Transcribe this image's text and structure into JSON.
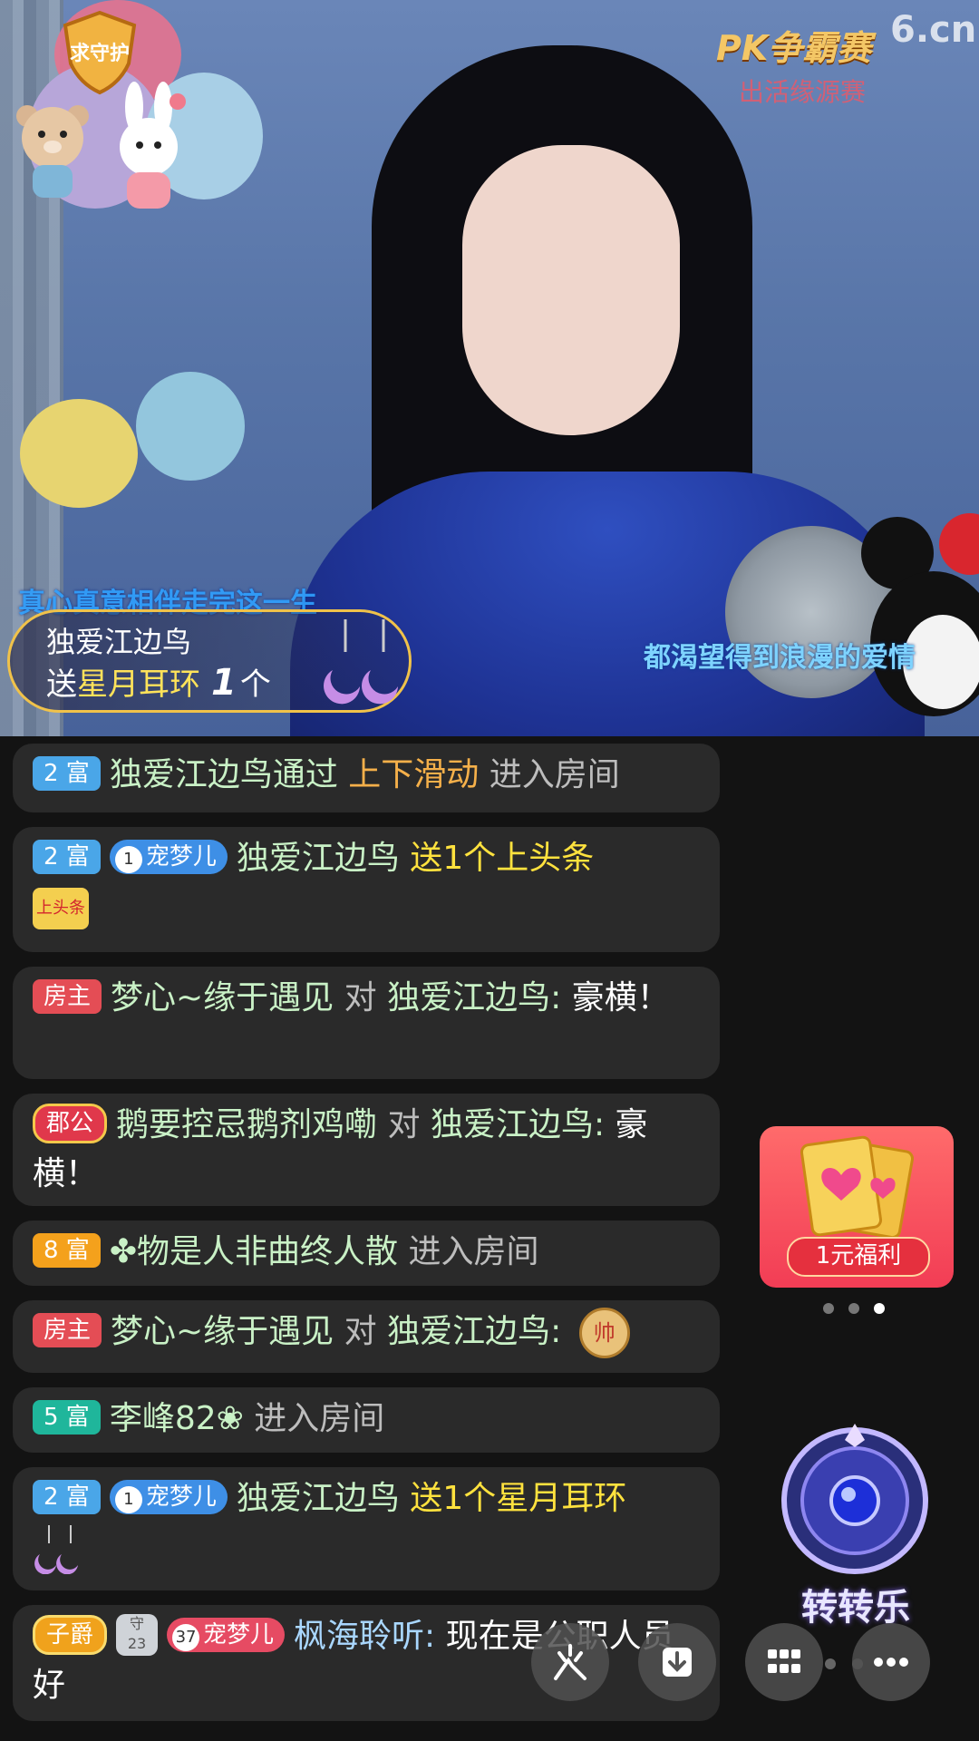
{
  "stream": {
    "logo_pk": "PK争霸赛",
    "logo_pk_sub": "出活缘源赛",
    "logo_site": "6.cn",
    "caption_top": "真心真意相伴走完这一生",
    "caption_right": "都渴望得到浪漫的爱情",
    "gift_banner": {
      "user": "独爱江边鸟",
      "send_prefix": "送",
      "gift_name": "星月耳环",
      "count": "1",
      "unit": "个"
    }
  },
  "chat": [
    {
      "badge": "2 富",
      "user": "独爱江边鸟",
      "text1": "通过",
      "text2": "上下滑动",
      "text3": "进入房间"
    },
    {
      "badge": "2 富",
      "pet_level": "1",
      "pet_name": "宠梦儿",
      "user": "独爱江边鸟",
      "action": "送1个上头条",
      "gift_label": "上头条"
    },
    {
      "badge": "房主",
      "user": "梦心~缘于遇见",
      "to": "对",
      "target": "独爱江边鸟:",
      "content": "豪横！"
    },
    {
      "badge": "郡公",
      "user": "鹅要控忌鹅剂鸡嘞",
      "to": "对",
      "target": "独爱江边鸟:",
      "content": "豪横！"
    },
    {
      "badge": "8 富",
      "user": "✤物是人非曲终人散",
      "text": "进入房间"
    },
    {
      "badge": "房主",
      "user": "梦心~缘于遇见",
      "to": "对",
      "target": "独爱江边鸟:",
      "emoji": "帅"
    },
    {
      "badge": "5 富",
      "user": "李峰82❀",
      "text": "进入房间"
    },
    {
      "badge": "2 富",
      "pet_level": "1",
      "pet_name": "宠梦儿",
      "user": "独爱江边鸟",
      "action": "送1个星月耳环"
    },
    {
      "badge": "子爵",
      "shield_text": "守",
      "shield_level": "23",
      "pet_level": "37",
      "pet_name": "宠梦儿",
      "user": "枫海聆听:",
      "content": "现在是公职人员好"
    }
  ],
  "promo": {
    "label": "1元福利"
  },
  "wheel": {
    "label": "转转乐"
  },
  "colors": {
    "name_green": "#c9f1c6",
    "gold": "#ffe23e",
    "orange": "#f5b04a",
    "host_red": "#e44d55",
    "level_blue": "#4aa6e8"
  },
  "icons": [
    "shield-guard-icon",
    "fire-icon",
    "download-icon",
    "grid-icon",
    "more-icon",
    "wheel-icon",
    "cards-icon",
    "earring-icon"
  ]
}
